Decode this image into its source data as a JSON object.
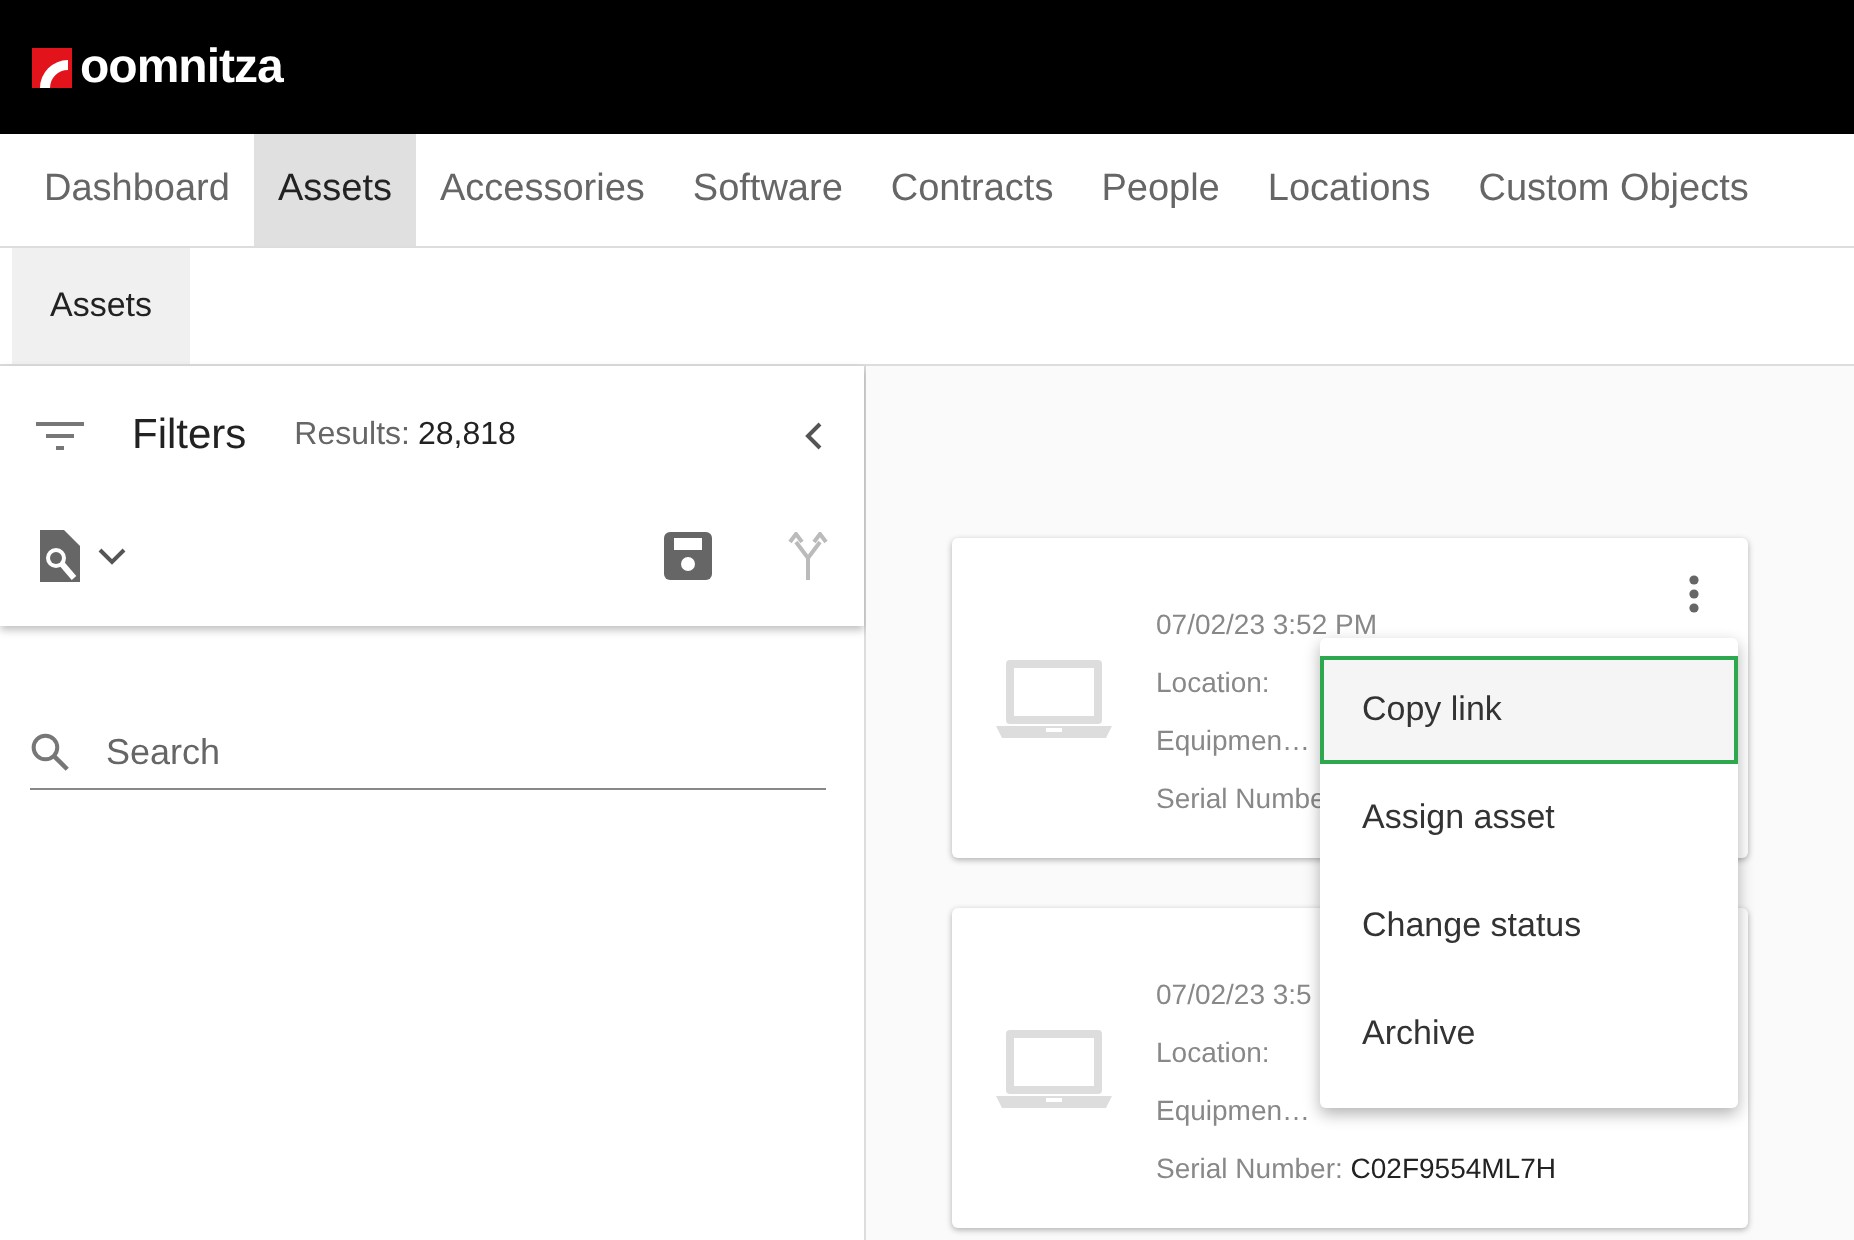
{
  "brand": {
    "name": "oomnitza"
  },
  "tabs": [
    {
      "label": "Dashboard",
      "selected": false
    },
    {
      "label": "Assets",
      "selected": true
    },
    {
      "label": "Accessories",
      "selected": false
    },
    {
      "label": "Software",
      "selected": false
    },
    {
      "label": "Contracts",
      "selected": false
    },
    {
      "label": "People",
      "selected": false
    },
    {
      "label": "Locations",
      "selected": false
    },
    {
      "label": "Custom Objects",
      "selected": false
    }
  ],
  "subtabs": [
    {
      "label": "Assets",
      "selected": true
    }
  ],
  "filters": {
    "title": "Filters",
    "results_label": "Results:",
    "results_value": "28,818",
    "search": {
      "placeholder": "Search"
    }
  },
  "cards": [
    {
      "date": "07/02/23 3:52 PM",
      "fields": [
        {
          "label": "Location:"
        },
        {
          "label": "Equipmen…"
        },
        {
          "label": "Serial Numbe"
        }
      ]
    },
    {
      "date": "07/02/23 3:5",
      "fields": [
        {
          "label": "Location:"
        },
        {
          "label": "Equipmen…"
        },
        {
          "label": "Serial Number:",
          "value": "C02F9554ML7H"
        }
      ]
    }
  ],
  "menu": [
    {
      "label": "Copy link",
      "selected": true
    },
    {
      "label": "Assign asset",
      "selected": false
    },
    {
      "label": "Change status",
      "selected": false
    },
    {
      "label": "Archive",
      "selected": false
    }
  ]
}
